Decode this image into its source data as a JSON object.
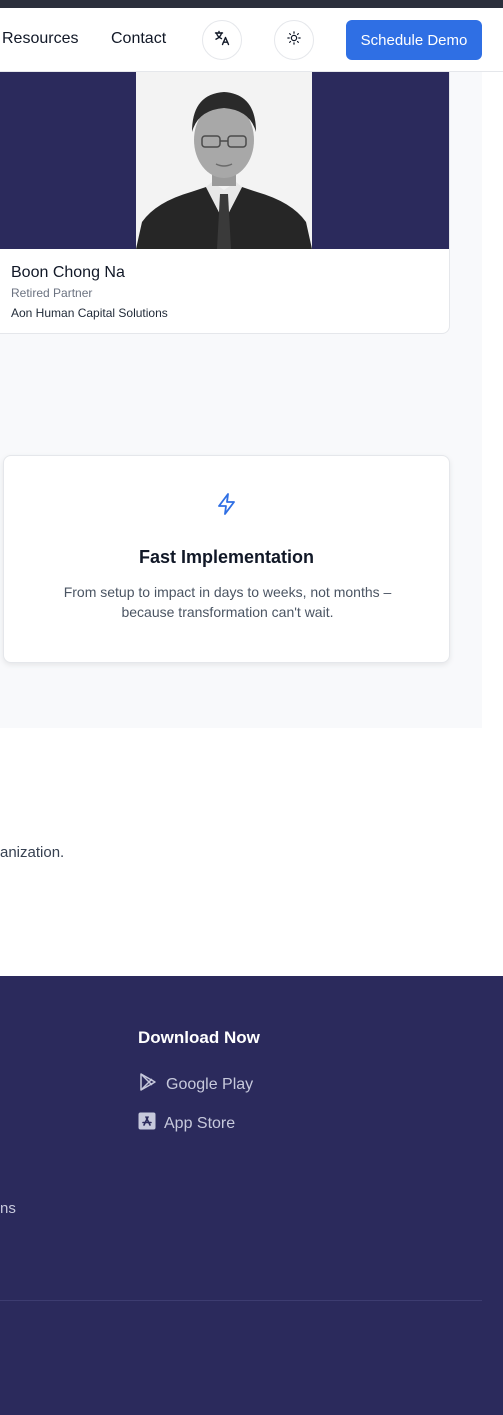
{
  "nav": {
    "resources": "Resources",
    "contact": "Contact",
    "translate_icon": "translate-icon",
    "theme_icon": "sun-icon",
    "demo_button": "Schedule Demo",
    "accent_color": "#2f6fe4"
  },
  "person": {
    "name": "Boon Chong Na",
    "role": "Retired Partner",
    "organization": "Aon Human Capital Solutions"
  },
  "feature": {
    "icon": "lightning-icon",
    "title": "Fast Implementation",
    "description": "From setup to impact in days to weeks, not months – because transformation can't wait."
  },
  "section_fragment": "anization.",
  "footer": {
    "heading": "Download Now",
    "google_play": "Google Play",
    "app_store": "App Store",
    "fragment": "ns",
    "background": "#2b2a5c"
  }
}
